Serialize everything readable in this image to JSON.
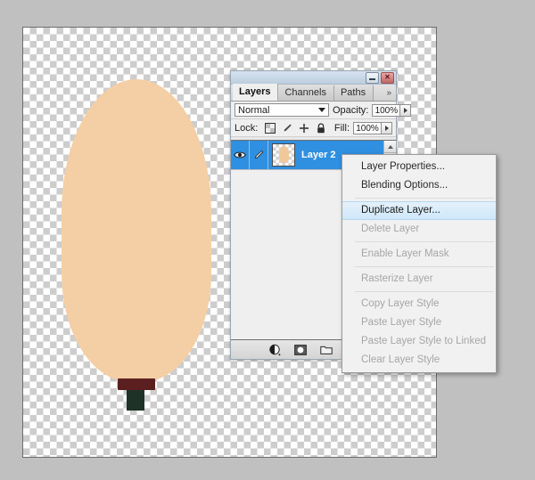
{
  "canvas": {
    "name": "document-canvas",
    "transparency": "checkerboard",
    "artwork_colors": {
      "body": "#f4cfa5",
      "band": "#5c1f1f",
      "stem": "#1e3228"
    }
  },
  "panel": {
    "title_buttons": {
      "minimize": "minimize",
      "close": "close"
    },
    "tabs": [
      {
        "label": "Layers",
        "active": true
      },
      {
        "label": "Channels",
        "active": false
      },
      {
        "label": "Paths",
        "active": false
      }
    ],
    "tabs_overflow": "»",
    "blend_mode": {
      "value": "Normal",
      "placeholder": "Blend Mode"
    },
    "opacity": {
      "label": "Opacity:",
      "value": "100%"
    },
    "lock": {
      "label": "Lock:",
      "icons": [
        "lock-transparency-icon",
        "lock-image-pixels-icon",
        "lock-position-icon",
        "lock-all-icon"
      ]
    },
    "fill": {
      "label": "Fill:",
      "value": "100%"
    },
    "layers": [
      {
        "name": "Layer 2",
        "visible": true,
        "selected": true,
        "has_brush": true
      }
    ],
    "footer_icons": [
      "layer-style-icon",
      "layer-mask-icon",
      "new-group-icon",
      "adjustment-layer-icon"
    ]
  },
  "context_menu": {
    "items": [
      {
        "label": "Layer Properties...",
        "disabled": false,
        "highlight": false,
        "separator_after": false
      },
      {
        "label": "Blending Options...",
        "disabled": false,
        "highlight": false,
        "separator_after": true
      },
      {
        "label": "Duplicate Layer...",
        "disabled": false,
        "highlight": true,
        "separator_after": false
      },
      {
        "label": "Delete Layer",
        "disabled": true,
        "highlight": false,
        "separator_after": true
      },
      {
        "label": "Enable Layer Mask",
        "disabled": true,
        "highlight": false,
        "separator_after": true
      },
      {
        "label": "Rasterize Layer",
        "disabled": true,
        "highlight": false,
        "separator_after": true
      },
      {
        "label": "Copy Layer Style",
        "disabled": true,
        "highlight": false,
        "separator_after": false
      },
      {
        "label": "Paste Layer Style",
        "disabled": true,
        "highlight": false,
        "separator_after": false
      },
      {
        "label": "Paste Layer Style to Linked",
        "disabled": true,
        "highlight": false,
        "separator_after": false
      },
      {
        "label": "Clear Layer Style",
        "disabled": true,
        "highlight": false,
        "separator_after": false
      }
    ]
  },
  "colors": {
    "app_background": "#c0c0c0",
    "selection_blue": "#2f8fe0",
    "highlight_blue": "#cfe8f9"
  }
}
